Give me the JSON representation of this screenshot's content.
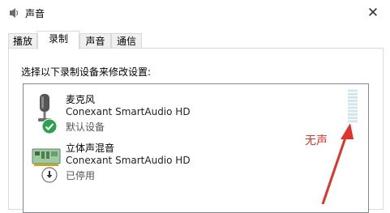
{
  "window": {
    "title": "声音",
    "close_glyph": "✕",
    "icon": "speaker-icon"
  },
  "tabs": [
    {
      "label": "播放",
      "active": false
    },
    {
      "label": "录制",
      "active": true
    },
    {
      "label": "声音",
      "active": false
    },
    {
      "label": "通信",
      "active": false
    }
  ],
  "recording": {
    "instruction": "选择以下录制设备来修改设置:",
    "devices": [
      {
        "name": "麦克风",
        "driver": "Conexant SmartAudio HD",
        "status": "默认设备",
        "icon": "microphone-icon",
        "badge": "default-checkmark-icon"
      },
      {
        "name": "立体声混音",
        "driver": "Conexant SmartAudio HD",
        "status": "已停用",
        "icon": "sound-card-icon",
        "badge": "disabled-down-arrow-icon"
      }
    ],
    "level_meter": {
      "level": 0,
      "segments": 10
    }
  },
  "annotation": {
    "text": "无声",
    "color": "#e0332a"
  }
}
